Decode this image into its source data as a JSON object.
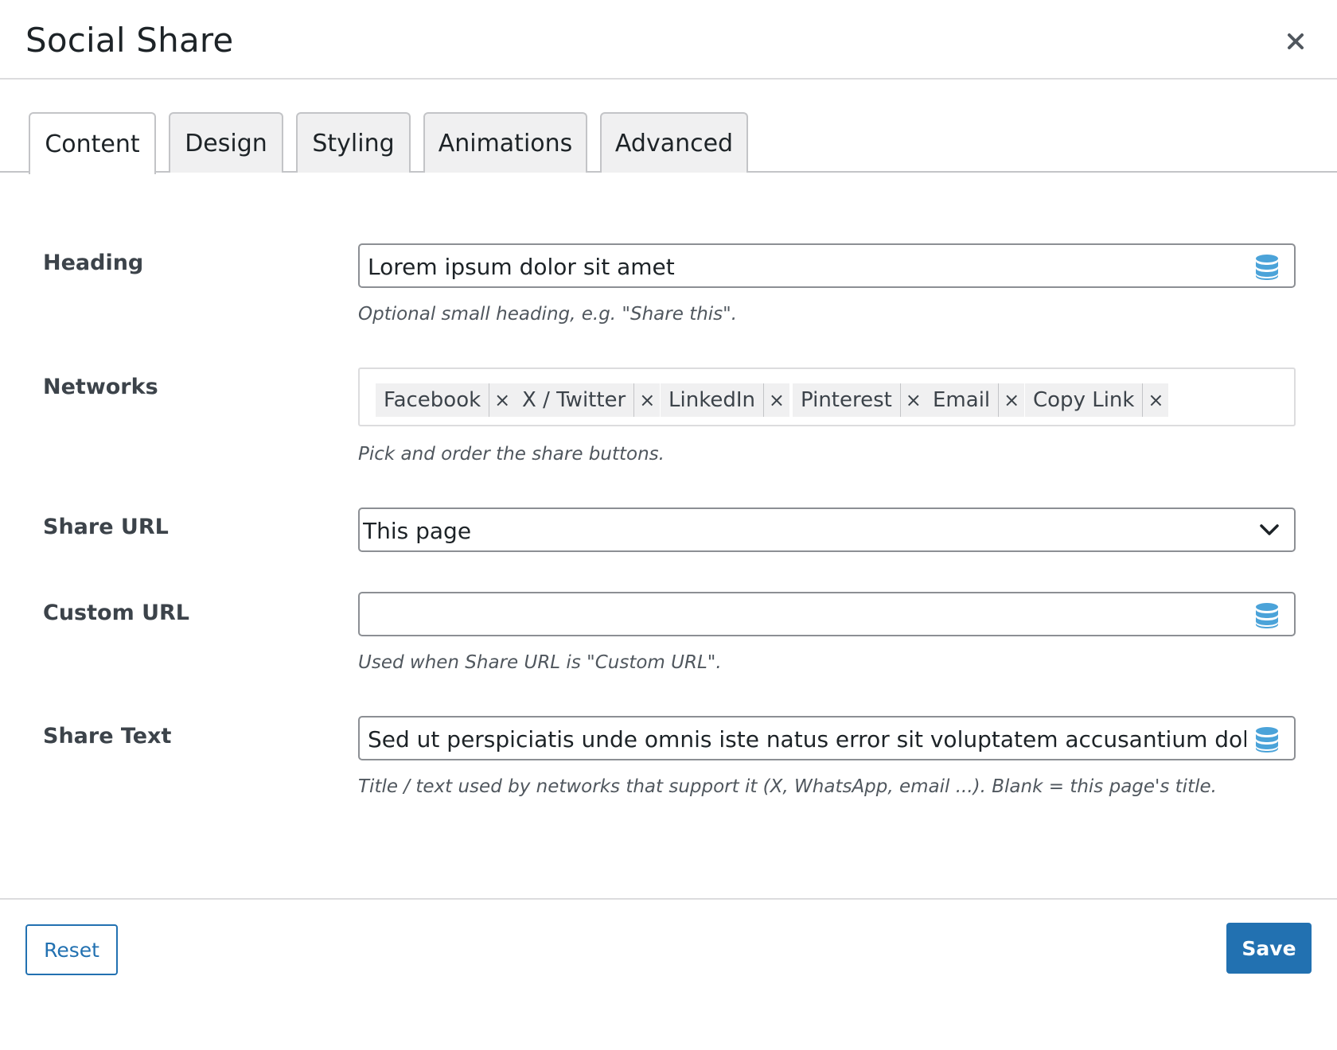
{
  "dialog": {
    "title": "Social Share",
    "close_icon": "close-icon"
  },
  "tabs": [
    {
      "label": "Content",
      "active": true
    },
    {
      "label": "Design",
      "active": false
    },
    {
      "label": "Styling",
      "active": false
    },
    {
      "label": "Animations",
      "active": false
    },
    {
      "label": "Advanced",
      "active": false
    }
  ],
  "fields": {
    "heading": {
      "label": "Heading",
      "value": "Lorem ipsum dolor sit amet",
      "help": "Optional small heading, e.g. \"Share this\".",
      "icon": "database-icon"
    },
    "networks": {
      "label": "Networks",
      "tags": [
        "Facebook",
        "X / Twitter",
        "LinkedIn",
        "Pinterest",
        "Email",
        "Copy Link"
      ],
      "remove_glyph": "×",
      "help": "Pick and order the share buttons."
    },
    "share_url": {
      "label": "Share URL",
      "selected": "This page",
      "icon": "chevron-down-icon"
    },
    "custom_url": {
      "label": "Custom URL",
      "value": "",
      "help": "Used when Share URL is \"Custom URL\".",
      "icon": "database-icon"
    },
    "share_text": {
      "label": "Share Text",
      "value": "Sed ut perspiciatis unde omnis iste natus error sit voluptatem accusantium doloremque la",
      "help": "Title / text used by networks that support it (X, WhatsApp, email ...). Blank = this page's title.",
      "icon": "database-icon"
    }
  },
  "footer": {
    "reset_label": "Reset",
    "save_label": "Save"
  },
  "colors": {
    "accent": "#2271b1",
    "db_icon": "#4ba3d9"
  }
}
